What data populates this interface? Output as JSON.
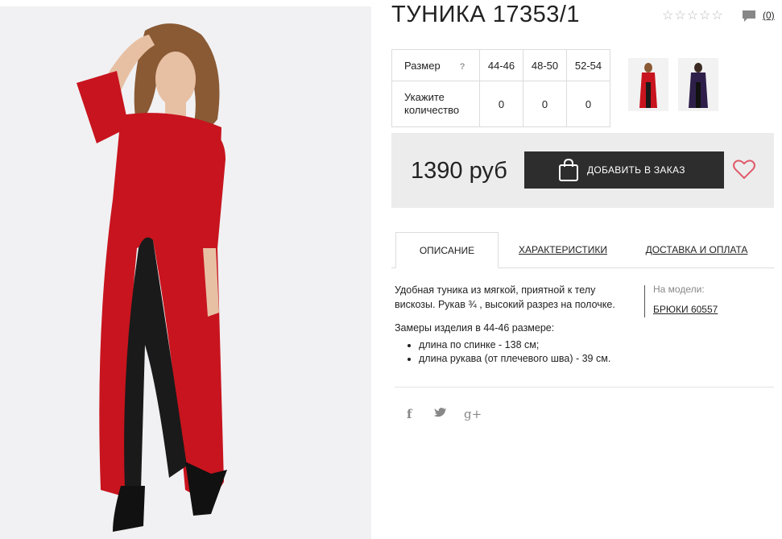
{
  "product": {
    "title": "ТУНИКА 17353/1",
    "rating_stars": "☆☆☆☆☆",
    "comment_count": "(0)"
  },
  "size_table": {
    "size_label": "Размер",
    "help_symbol": "?",
    "sizes": [
      "44-46",
      "48-50",
      "52-54"
    ],
    "qty_label_line1": "Укажите",
    "qty_label_line2": "количество",
    "quantities": [
      "0",
      "0",
      "0"
    ]
  },
  "purchase": {
    "price": "1390 руб",
    "add_button_label": "ДОБАВИТЬ В ЗАКАЗ"
  },
  "tabs": [
    "ОПИСАНИЕ",
    "ХАРАКТЕРИСТИКИ",
    "ДОСТАВКА И ОПЛАТА"
  ],
  "description": {
    "text": "Удобная туника из мягкой, приятной к телу вискозы. Рукав ¾ , высокий разрез на полочке.",
    "on_model_label": "На модели:",
    "on_model_link": "БРЮКИ 60557",
    "measurements_title": "Замеры изделия в 44-46 размере:",
    "measurements": [
      "длина по спинке - 138 см;",
      "длина рукава (от плечевого шва) - 39 см."
    ]
  },
  "social": [
    "f",
    "t",
    "g+"
  ],
  "colors": {
    "dress_red": "#c8141e",
    "button_dark": "#2d2d2d",
    "heart": "#e05a6a",
    "price_bg": "#ececec"
  }
}
